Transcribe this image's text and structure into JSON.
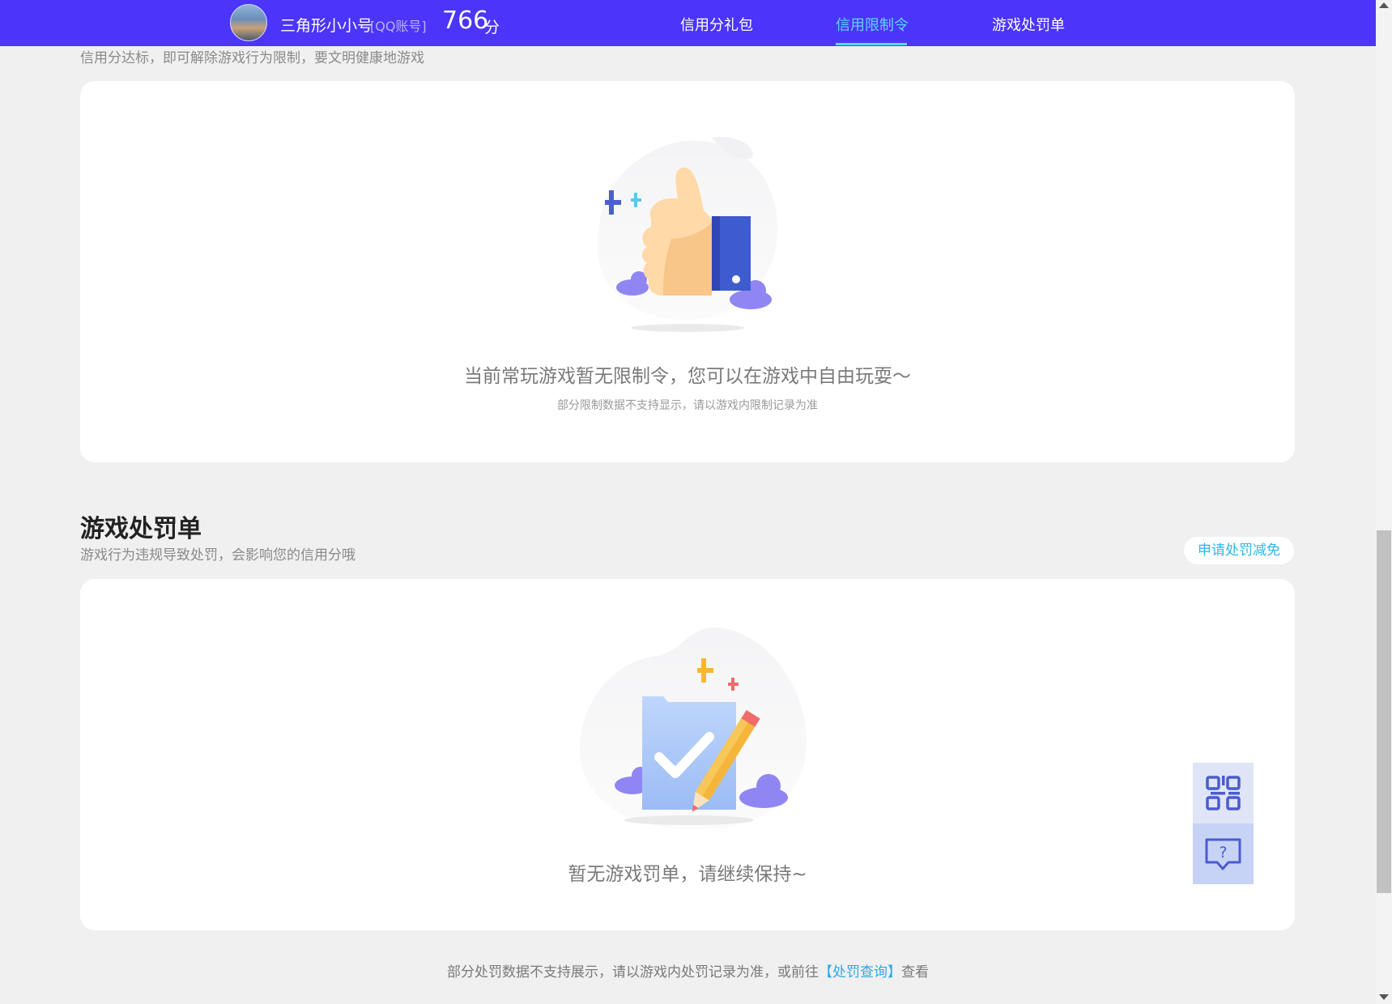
{
  "header": {
    "username": "三角形小小号",
    "account_type": "[QQ账号]",
    "score": "766",
    "score_unit": "分",
    "tabs": [
      {
        "label": "信用分礼包",
        "active": false
      },
      {
        "label": "信用限制令",
        "active": true
      },
      {
        "label": "游戏处罚单",
        "active": false
      }
    ],
    "bar_color": "#4b35f8",
    "active_color": "#58d6ff"
  },
  "restrictions": {
    "subtitle": "信用分达标，即可解除游戏行为限制，要文明健康地游戏",
    "empty_title": "当前常玩游戏暂无限制令，您可以在游戏中自由玩耍～",
    "empty_note": "部分限制数据不支持显示，请以游戏内限制记录为准",
    "illustration_icon": "thumbs-up-illustration"
  },
  "penalties": {
    "title": "游戏处罚单",
    "subtitle": "游戏行为违规导致处罚，会影响您的信用分哦",
    "appeal_label": "申请处罚减免",
    "empty_title": "暂无游戏罚单，请继续保持~",
    "illustration_icon": "document-check-illustration"
  },
  "footer": {
    "text_before": "部分处罚数据不支持展示，请以游戏内处罚记录为准，或前往",
    "link_label": "【处罚查询】",
    "text_after": "查看"
  },
  "float_tools": {
    "qr_icon": "qr-code-icon",
    "help_icon": "help-chat-icon"
  }
}
